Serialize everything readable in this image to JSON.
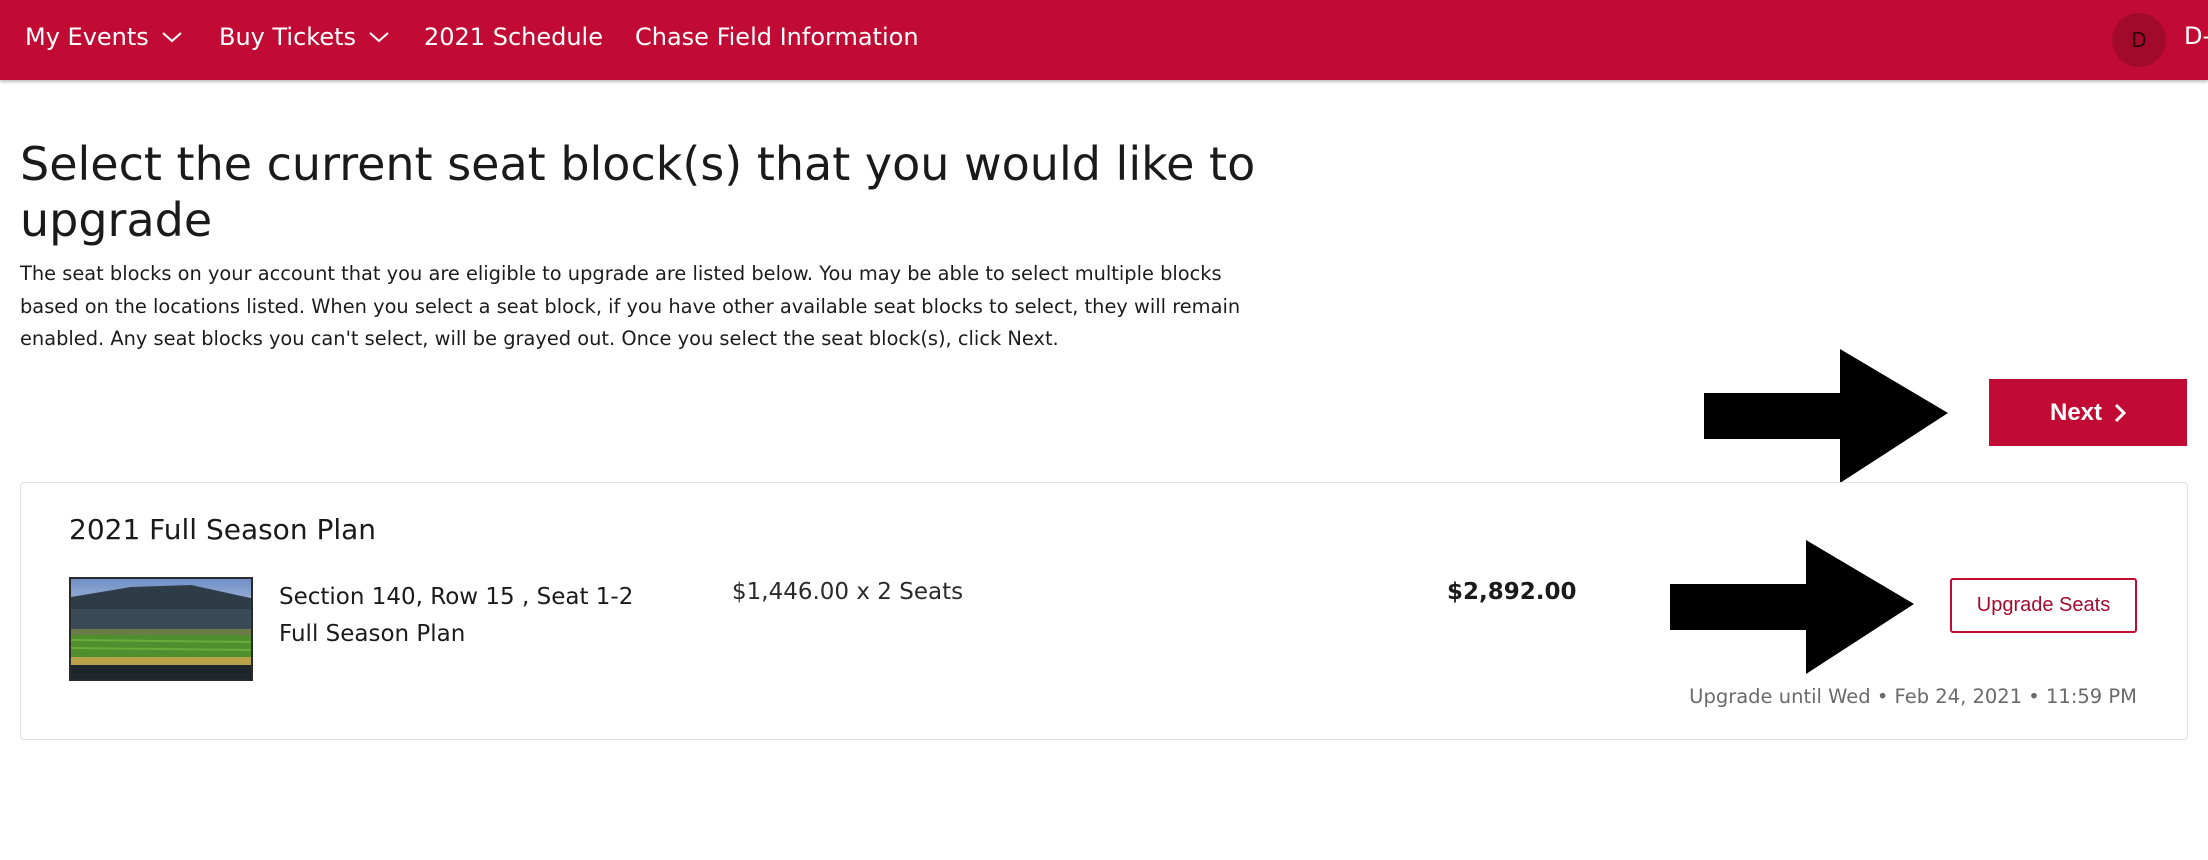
{
  "colors": {
    "brand": "#c10a34",
    "text": "#1a1a1a",
    "muted": "#6a6a6a",
    "card_border": "#e2e2e2"
  },
  "nav": {
    "items": [
      {
        "label": "My Events",
        "has_dropdown": true,
        "icon": "chevron-down-icon"
      },
      {
        "label": "Buy Tickets",
        "has_dropdown": true,
        "icon": "chevron-down-icon"
      },
      {
        "label": "2021 Schedule",
        "has_dropdown": false
      },
      {
        "label": "Chase Field Information",
        "has_dropdown": false
      }
    ],
    "avatar_initial": "D",
    "account_label": "D-"
  },
  "page": {
    "title": "Select the current seat block(s) that you would like to upgrade",
    "intro": "The seat blocks on your account that you are eligible to upgrade are listed below. You may be able to select multiple blocks based on the locations listed. When you select a seat block, if you have other available seat blocks to select, they will remain enabled. Any seat blocks you can't select, will be grayed out. Once you select the seat block(s), click Next.",
    "next_label": "Next",
    "next_icon": "chevron-right-icon"
  },
  "seat_block": {
    "plan_title": "2021 Full Season Plan",
    "image_icon": "stadium-field-photo",
    "seat_line": "Section 140, Row 15 , Seat 1-2",
    "plan_name": "Full Season Plan",
    "price_each": "$1,446.00 x 2 Seats",
    "total": "$2,892.00",
    "upgrade_label": "Upgrade Seats",
    "deadline": "Upgrade until Wed • Feb 24, 2021 • 11:59 PM"
  },
  "annotations": {
    "arrow_icon": "right-arrow-icon"
  }
}
